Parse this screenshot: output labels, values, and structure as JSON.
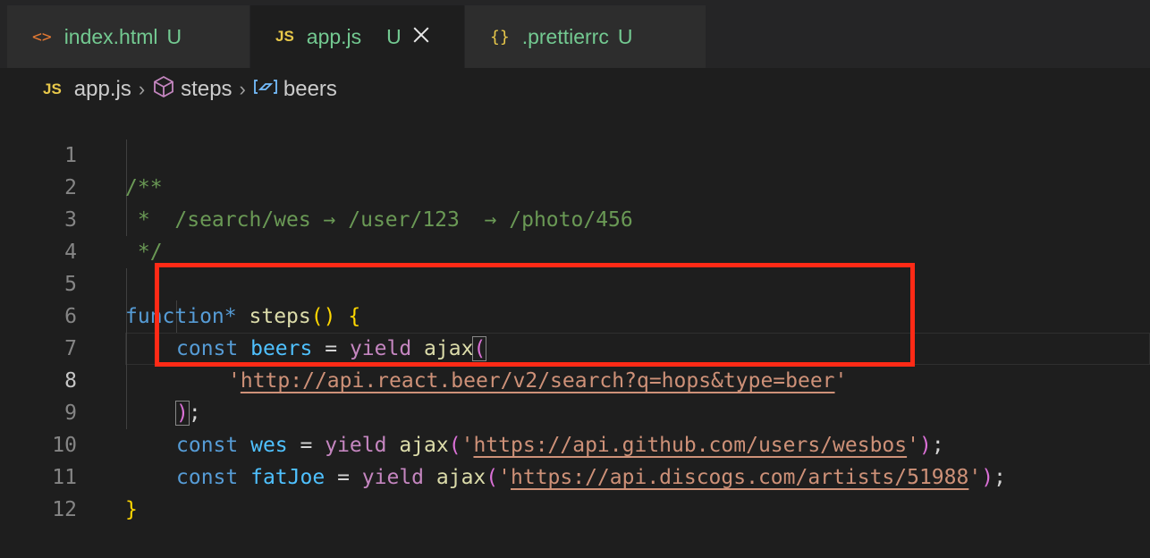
{
  "tabs": [
    {
      "icon": "<>",
      "label": "index.html",
      "status": "U",
      "active": false
    },
    {
      "icon": "JS",
      "label": "app.js",
      "status": "U",
      "active": true
    },
    {
      "icon": "{}",
      "label": ".prettierrc",
      "status": "U",
      "active": false
    }
  ],
  "breadcrumb": {
    "file_badge": "JS",
    "file": "app.js",
    "symbol": "steps",
    "variable": "beers"
  },
  "editor": {
    "line_numbers": [
      "1",
      "2",
      "3",
      "4",
      "5",
      "6",
      "7",
      "8",
      "9",
      "10",
      "11",
      "12"
    ],
    "current_line": "8",
    "code": {
      "l1": "/**",
      "l2": " *  /search/wes → /user/123  → /photo/456",
      "l3": " */",
      "l5_kw": "function",
      "l5_star": "*",
      "l5_name": "steps",
      "l6_kw": "const",
      "l6_var": "beers",
      "l6_ctl": "yield",
      "l6_fn": "ajax",
      "l7_url": "http://api.react.beer/v2/search?q=hops&type=beer",
      "l9_kw": "const",
      "l9_var": "wes",
      "l9_ctl": "yield",
      "l9_fn": "ajax",
      "l9_url": "https://api.github.com/users/wesbos",
      "l10_kw": "const",
      "l10_var": "fatJoe",
      "l10_ctl": "yield",
      "l10_fn": "ajax",
      "l10_url": "https://api.discogs.com/artists/51988"
    }
  },
  "colors": {
    "highlight_box": "#ff2a16",
    "background": "#1e1e1e",
    "untracked": "#73c991"
  }
}
